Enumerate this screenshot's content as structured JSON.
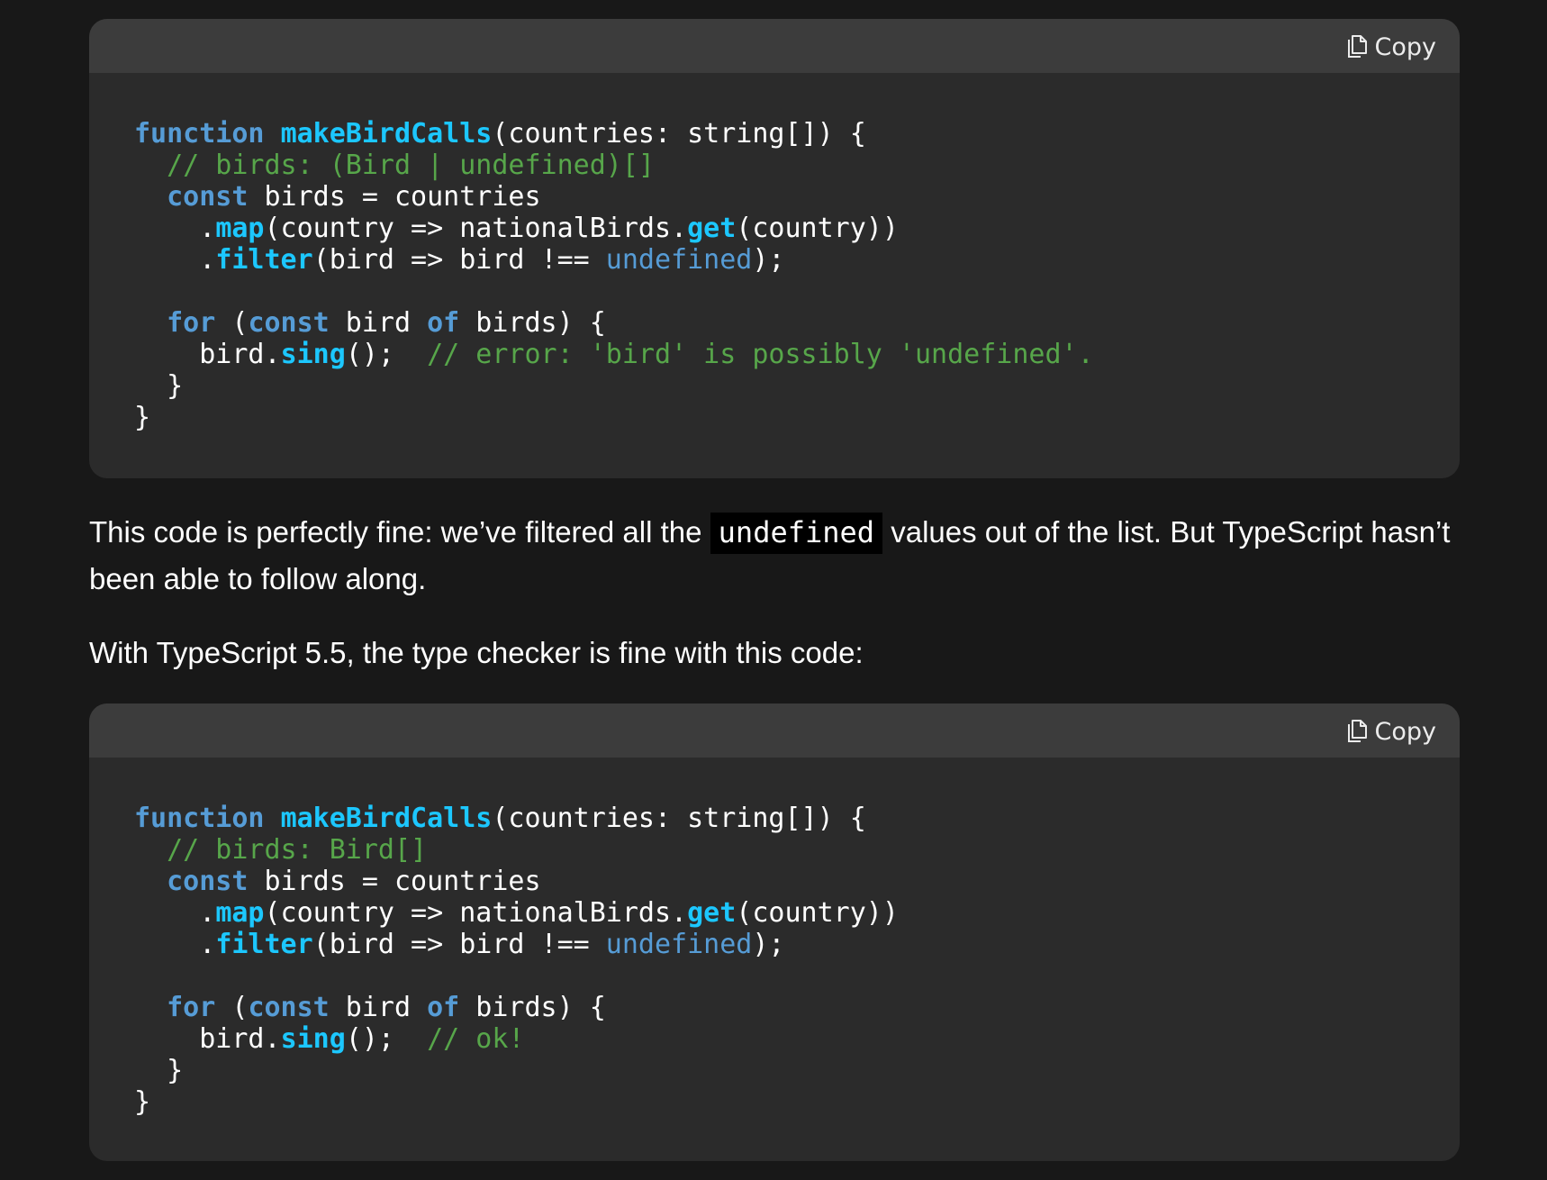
{
  "code_blocks": [
    {
      "copy_label": "Copy",
      "lines": [
        [
          {
            "t": "kw",
            "v": "function"
          },
          {
            "t": "plain",
            "v": " "
          },
          {
            "t": "fn",
            "v": "makeBirdCalls"
          },
          {
            "t": "plain",
            "v": "(countries: string[]) {"
          }
        ],
        [
          {
            "t": "plain",
            "v": "  "
          },
          {
            "t": "cm",
            "v": "// birds: (Bird | undefined)[]"
          }
        ],
        [
          {
            "t": "plain",
            "v": "  "
          },
          {
            "t": "kw",
            "v": "const"
          },
          {
            "t": "plain",
            "v": " birds = countries"
          }
        ],
        [
          {
            "t": "plain",
            "v": "    ."
          },
          {
            "t": "fn",
            "v": "map"
          },
          {
            "t": "plain",
            "v": "(country => nationalBirds."
          },
          {
            "t": "fn",
            "v": "get"
          },
          {
            "t": "plain",
            "v": "(country))"
          }
        ],
        [
          {
            "t": "plain",
            "v": "    ."
          },
          {
            "t": "fn",
            "v": "filter"
          },
          {
            "t": "plain",
            "v": "(bird => bird !== "
          },
          {
            "t": "lit",
            "v": "undefined"
          },
          {
            "t": "plain",
            "v": ");"
          }
        ],
        [
          {
            "t": "plain",
            "v": ""
          }
        ],
        [
          {
            "t": "plain",
            "v": "  "
          },
          {
            "t": "kw",
            "v": "for"
          },
          {
            "t": "plain",
            "v": " ("
          },
          {
            "t": "kw",
            "v": "const"
          },
          {
            "t": "plain",
            "v": " bird "
          },
          {
            "t": "kw",
            "v": "of"
          },
          {
            "t": "plain",
            "v": " birds) {"
          }
        ],
        [
          {
            "t": "plain",
            "v": "    bird."
          },
          {
            "t": "fn",
            "v": "sing"
          },
          {
            "t": "plain",
            "v": "();  "
          },
          {
            "t": "cm",
            "v": "// error: 'bird' is possibly 'undefined'."
          }
        ],
        [
          {
            "t": "plain",
            "v": "  }"
          }
        ],
        [
          {
            "t": "plain",
            "v": "}"
          }
        ]
      ]
    },
    {
      "copy_label": "Copy",
      "lines": [
        [
          {
            "t": "kw",
            "v": "function"
          },
          {
            "t": "plain",
            "v": " "
          },
          {
            "t": "fn",
            "v": "makeBirdCalls"
          },
          {
            "t": "plain",
            "v": "(countries: string[]) {"
          }
        ],
        [
          {
            "t": "plain",
            "v": "  "
          },
          {
            "t": "cm",
            "v": "// birds: Bird[]"
          }
        ],
        [
          {
            "t": "plain",
            "v": "  "
          },
          {
            "t": "kw",
            "v": "const"
          },
          {
            "t": "plain",
            "v": " birds = countries"
          }
        ],
        [
          {
            "t": "plain",
            "v": "    ."
          },
          {
            "t": "fn",
            "v": "map"
          },
          {
            "t": "plain",
            "v": "(country => nationalBirds."
          },
          {
            "t": "fn",
            "v": "get"
          },
          {
            "t": "plain",
            "v": "(country))"
          }
        ],
        [
          {
            "t": "plain",
            "v": "    ."
          },
          {
            "t": "fn",
            "v": "filter"
          },
          {
            "t": "plain",
            "v": "(bird => bird !== "
          },
          {
            "t": "lit",
            "v": "undefined"
          },
          {
            "t": "plain",
            "v": ");"
          }
        ],
        [
          {
            "t": "plain",
            "v": ""
          }
        ],
        [
          {
            "t": "plain",
            "v": "  "
          },
          {
            "t": "kw",
            "v": "for"
          },
          {
            "t": "plain",
            "v": " ("
          },
          {
            "t": "kw",
            "v": "const"
          },
          {
            "t": "plain",
            "v": " bird "
          },
          {
            "t": "kw",
            "v": "of"
          },
          {
            "t": "plain",
            "v": " birds) {"
          }
        ],
        [
          {
            "t": "plain",
            "v": "    bird."
          },
          {
            "t": "fn",
            "v": "sing"
          },
          {
            "t": "plain",
            "v": "();  "
          },
          {
            "t": "cm",
            "v": "// ok!"
          }
        ],
        [
          {
            "t": "plain",
            "v": "  }"
          }
        ],
        [
          {
            "t": "plain",
            "v": "}"
          }
        ]
      ]
    }
  ],
  "paragraph1": {
    "before": "This code is perfectly fine: we’ve filtered all the ",
    "code": "undefined",
    "after": " values out of the list. But TypeScript hasn’t been able to follow along."
  },
  "paragraph2": {
    "text": "With TypeScript 5.5, the type checker is fine with this code:"
  },
  "colors": {
    "background": "#181818",
    "code_background": "#2b2b2b",
    "code_header": "#3c3c3c",
    "keyword": "#569cd6",
    "function": "#1cc7ff",
    "comment": "#57a64a",
    "text": "#ffffff"
  },
  "icons": {
    "copy": "copy-icon"
  }
}
